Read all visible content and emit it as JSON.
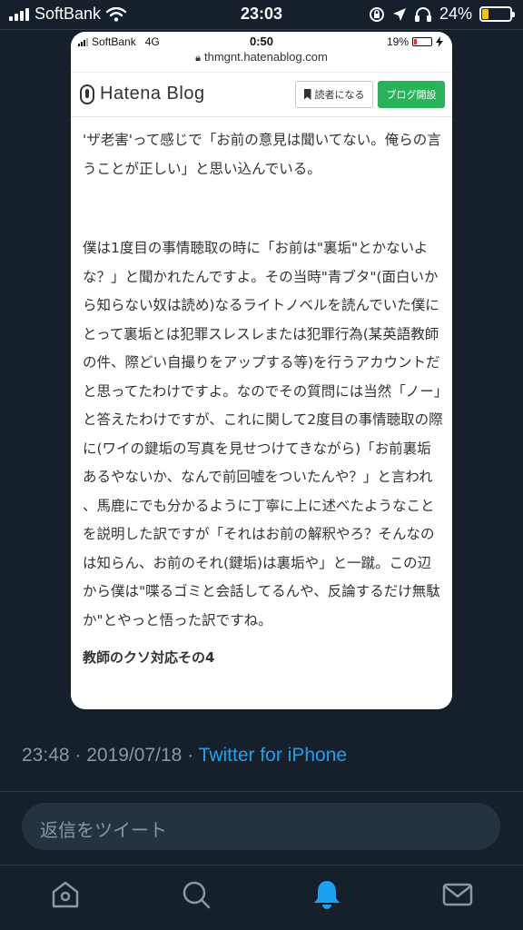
{
  "status_bar": {
    "carrier": "SoftBank",
    "time": "23:03",
    "battery_percent": "24%",
    "battery_level": 0.24,
    "battery_color": "#f5c400"
  },
  "inner_screenshot": {
    "status_bar": {
      "carrier": "SoftBank",
      "network": "4G",
      "time": "0:50",
      "battery_percent": "19%",
      "battery_level": 0.19
    },
    "url": "thmgnt.hatenablog.com",
    "header": {
      "logo_text": "Hatena Blog",
      "reader_button_label": "読者になる",
      "open_blog_button_label": "ブログ開設",
      "open_blog_button_color": "#2bb35b"
    },
    "article": {
      "paragraphs": [
        "'ザ老害'って感じで「お前の意見は聞いてない。俺らの言うことが正しい」と思い込んでいる。",
        "僕は1度目の事情聴取の時に「お前は\"裏垢\"とかないよな？」と聞かれたんですよ。その当時\"青ブタ\"(面白いから知らない奴は読め)なるライトノベルを読んでいた僕にとって裏垢とは犯罪スレスレまたは犯罪行為(某英語教師の件、際どい自撮りをアップする等)を行うアカウントだと思ってたわけですよ。なのでその質問には当然「ノー」と答えたわけですが、これに関して2度目の事情聴取の際に(ワイの鍵垢の写真を見せつけてきながら)「お前裏垢あるやないか、なんで前回嘘をついたんや？」と言われ 、馬鹿にでも分かるように丁寧に上に述べたようなことを説明した訳ですが「それはお前の解釈やろ？そんなのは知らん、お前のそれ(鍵垢)は裏垢や」と一蹴。この辺から僕は\"喋るゴミと会話してるんや、反論するだけ無駄か\"とやっと悟った訳ですね。"
      ],
      "heading": "教師のクソ対応その4"
    }
  },
  "tweet_meta": {
    "time": "23:48",
    "date": "2019/07/18",
    "separator": "·",
    "via": "Twitter for iPhone"
  },
  "reply_placeholder": "返信をツイート",
  "tabbar": {
    "items": [
      {
        "icon": "home-icon",
        "active": false
      },
      {
        "icon": "search-icon",
        "active": false
      },
      {
        "icon": "bell-icon",
        "active": true
      },
      {
        "icon": "mail-icon",
        "active": false
      }
    ],
    "active_color": "#1da1f2",
    "inactive_color": "#8899a6"
  }
}
